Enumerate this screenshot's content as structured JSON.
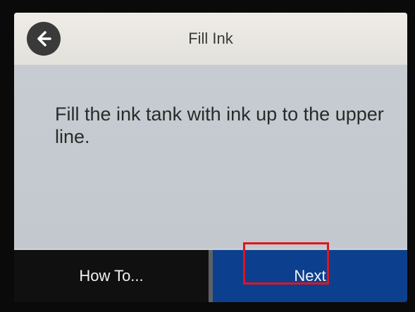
{
  "header": {
    "title": "Fill Ink"
  },
  "message": {
    "text": "Fill the ink tank with ink up to the upper line."
  },
  "footer": {
    "howto_label": "How To...",
    "next_label": "Next"
  },
  "colors": {
    "next_button": "#0d3f8f",
    "highlight": "#e0141e",
    "screen_background": "#c8ced3"
  }
}
